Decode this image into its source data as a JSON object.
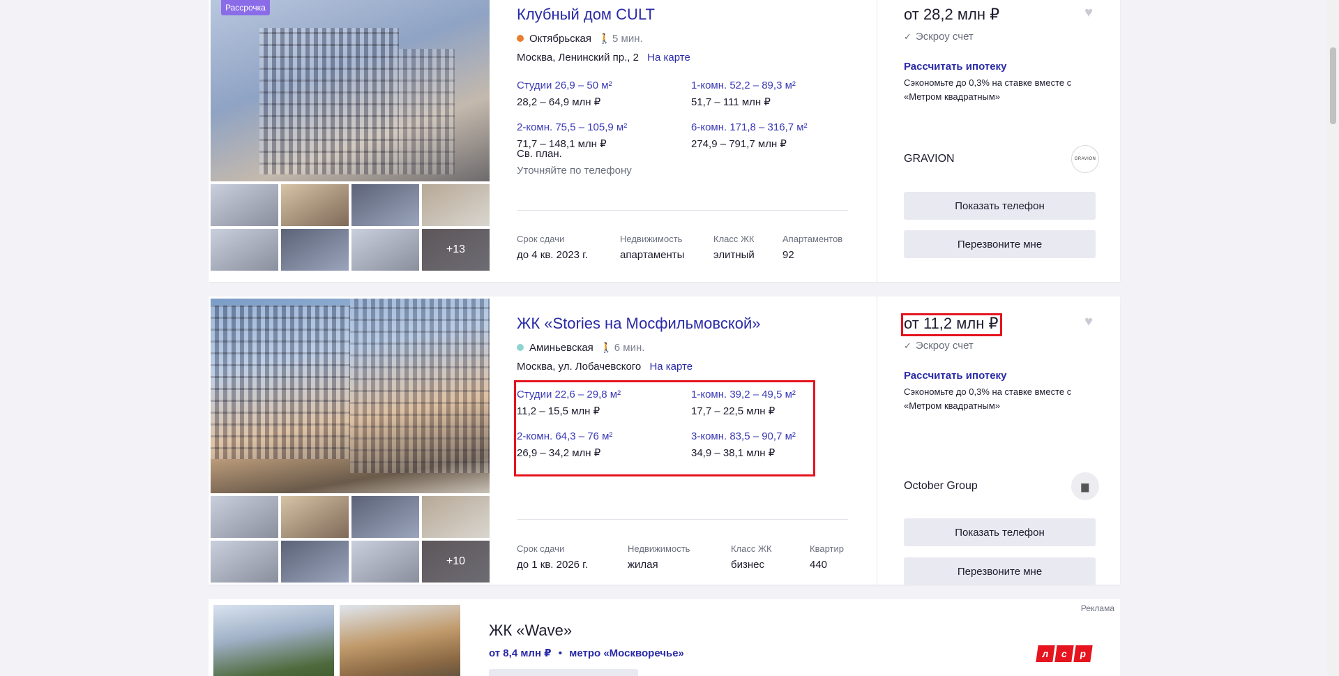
{
  "listings": [
    {
      "badge": "Рассрочка",
      "title": "Клубный дом CULT",
      "metro": {
        "station": "Октябрьская",
        "walk": "5 мин.",
        "color": "#e97e2f"
      },
      "address": "Москва, Ленинский пр., 2",
      "map_link": "На карте",
      "flats": [
        {
          "type": "Студии 26,9 – 50 м²",
          "price": "28,2 – 64,9 млн ₽"
        },
        {
          "type": "1-комн. 52,2 – 89,3 м²",
          "price": "51,7 – 111 млн ₽"
        },
        {
          "type": "2-комн. 75,5 – 105,9 м²",
          "price": "71,7 – 148,1 млн ₽"
        },
        {
          "type": "6-комн. 171,8 – 316,7 м²",
          "price": "274,9 – 791,7 млн ₽"
        }
      ],
      "extra_type": "Св. план.",
      "extra_note": "Уточняйте по телефону",
      "specs": [
        {
          "label": "Срок сдачи",
          "value": "до 4 кв. 2023 г."
        },
        {
          "label": "Недвижимость",
          "value": "апартаменты"
        },
        {
          "label": "Класс ЖК",
          "value": "элитный"
        },
        {
          "label": "Апартаментов",
          "value": "92"
        }
      ],
      "thumbs_more": "+13",
      "price": "от 28,2 млн ₽",
      "escrow": "Эскроу счет",
      "mortgage_link": "Рассчитать ипотеку",
      "mortgage_text": "Сэкономьте до 0,3% на ставке вместе с «Метром квадратным»",
      "developer": "GRAVION",
      "developer_logo": "GRAVION",
      "show_phone": "Показать телефон",
      "callback": "Перезвоните мне"
    },
    {
      "title": "ЖК «Stories на Мосфильмовской»",
      "metro": {
        "station": "Аминьевская",
        "walk": "6 мин.",
        "color": "#8fd3d3"
      },
      "address": "Москва, ул. Лобачевского",
      "map_link": "На карте",
      "flats": [
        {
          "type": "Студии 22,6 – 29,8 м²",
          "price": "11,2 – 15,5 млн ₽"
        },
        {
          "type": "1-комн. 39,2 – 49,5 м²",
          "price": "17,7 – 22,5 млн ₽"
        },
        {
          "type": "2-комн. 64,3 – 76 м²",
          "price": "26,9 – 34,2 млн ₽"
        },
        {
          "type": "3-комн. 83,5 – 90,7 м²",
          "price": "34,9 – 38,1 млн ₽"
        }
      ],
      "specs": [
        {
          "label": "Срок сдачи",
          "value": "до 1 кв. 2026 г."
        },
        {
          "label": "Недвижимость",
          "value": "жилая"
        },
        {
          "label": "Класс ЖК",
          "value": "бизнес"
        },
        {
          "label": "Квартир",
          "value": "440"
        }
      ],
      "thumbs_more": "+10",
      "price": "от 11,2 млн ₽",
      "escrow": "Эскроу счет",
      "mortgage_link": "Рассчитать ипотеку",
      "mortgage_text": "Сэкономьте до 0,3% на ставке вместе с «Метром квадратным»",
      "developer": "October Group",
      "show_phone": "Показать телефон",
      "callback": "Перезвоните мне"
    }
  ],
  "ad": {
    "label": "Реклама",
    "title": "ЖК «Wave»",
    "price": "от 8,4 млн ₽",
    "separator": "•",
    "metro": "метро «Москворечье»",
    "logo_letters": [
      "л",
      "с",
      "р"
    ]
  },
  "colors": {
    "accent": "#2a2aa8",
    "highlight": "#e5141e",
    "badge": "#8a6ce8"
  }
}
